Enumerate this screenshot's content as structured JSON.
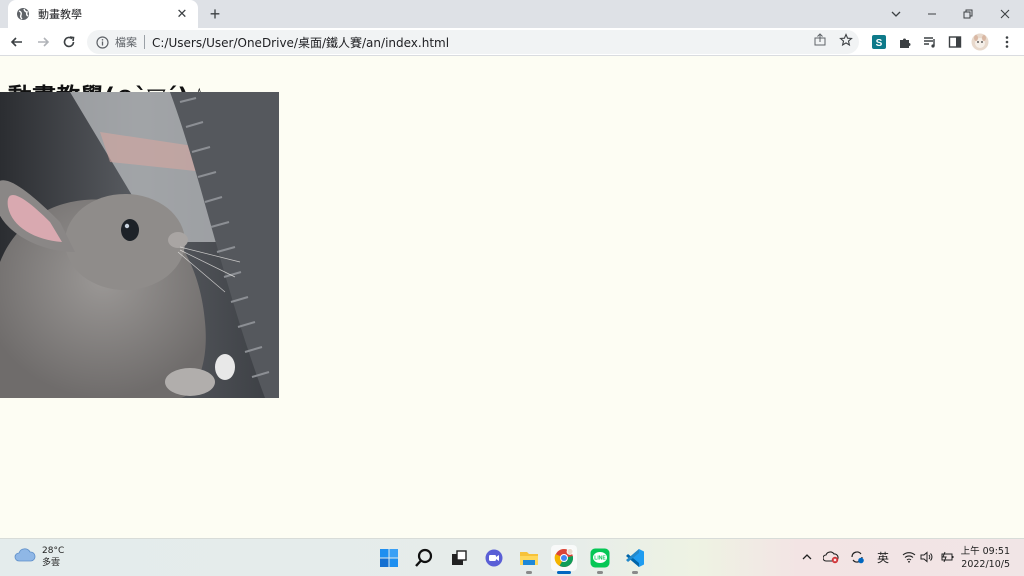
{
  "browser": {
    "tab": {
      "title": "動畫教學",
      "favicon": "globe-icon"
    },
    "omnibox": {
      "scheme_label": "檔案",
      "url": "C:/Users/User/OneDrive/桌面/鐵人賽/an/index.html"
    },
    "extensions": [
      "skype-extension",
      "puzzle-icon",
      "reading-list-icon",
      "side-panel-icon",
      "profile-avatar"
    ]
  },
  "page": {
    "heading": "動畫教學(⊙ˋ▽ˊ)☆",
    "image": {
      "subject": "gray-rabbit-photo"
    },
    "background_color": "#fdfdf3"
  },
  "taskbar": {
    "weather": {
      "temp": "28°C",
      "condition": "多雲"
    },
    "apps": [
      "windows-start",
      "search",
      "task-view",
      "teams-chat",
      "file-explorer",
      "chrome",
      "line",
      "vscode"
    ],
    "tray": {
      "ime": "英"
    },
    "clock": {
      "time": "上午 09:51",
      "date": "2022/10/5"
    }
  }
}
